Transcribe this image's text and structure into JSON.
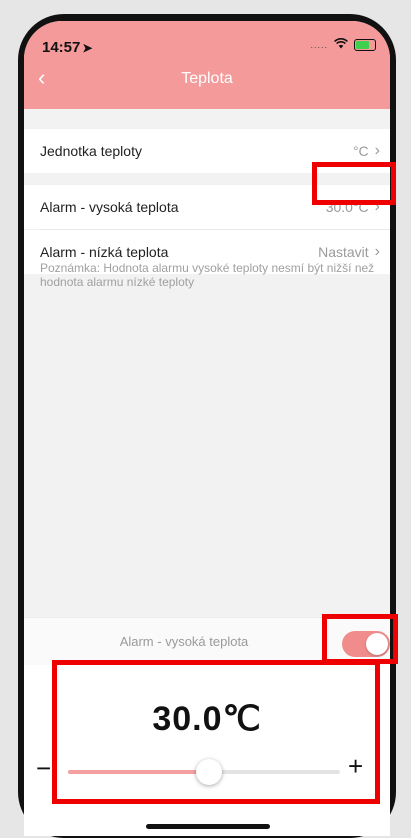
{
  "status_bar": {
    "time": "14:57",
    "dots": "....."
  },
  "header": {
    "title": "Teplota",
    "back_glyph": "‹"
  },
  "settings": [
    {
      "label": "Jednotka teploty",
      "value": "°C"
    },
    {
      "label": "Alarm - vysoká teplota",
      "value": "30.0°C"
    },
    {
      "label": "Alarm - nízká teplota",
      "value": "Nastavit"
    }
  ],
  "note": "Poznámka: Hodnota alarmu vysoké teploty nesmí být nižší než hodnota alarmu nízké teploty",
  "alarm_toggle": {
    "label": "Alarm - vysoká teplota",
    "on": true
  },
  "slider": {
    "display_value": "30.0℃",
    "minus": "−",
    "plus": "+",
    "fraction": 0.53
  },
  "colors": {
    "header": "#f59a9a",
    "accent": "#f08c8c",
    "highlight": "#ee0000"
  },
  "icons": {
    "chevron": "›",
    "location_arrow": "➤",
    "wifi": "wifi",
    "battery": "battery-charging"
  }
}
